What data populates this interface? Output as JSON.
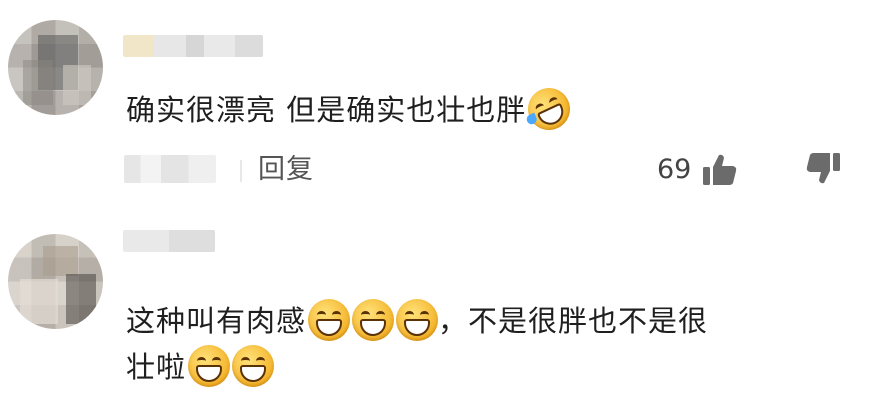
{
  "comments": [
    {
      "text": "确实很漂亮 但是确实也壮也胖",
      "emoji": "rolling-laughing",
      "reply_label": "回复",
      "like_count": "69"
    },
    {
      "text_line1": "这种叫有肉感",
      "text_after_emoji": "，不是很胖也不是很",
      "text_line2": "壮啦",
      "emoji_line1": [
        "grin",
        "grin",
        "grin"
      ],
      "emoji_line2": [
        "grin",
        "grin"
      ]
    }
  ],
  "colors": {
    "text": "#1f1f1f",
    "reply": "#555555",
    "emoji_face": "#f4b42a"
  },
  "icons": [
    "thumb-up-icon",
    "thumb-down-icon"
  ]
}
